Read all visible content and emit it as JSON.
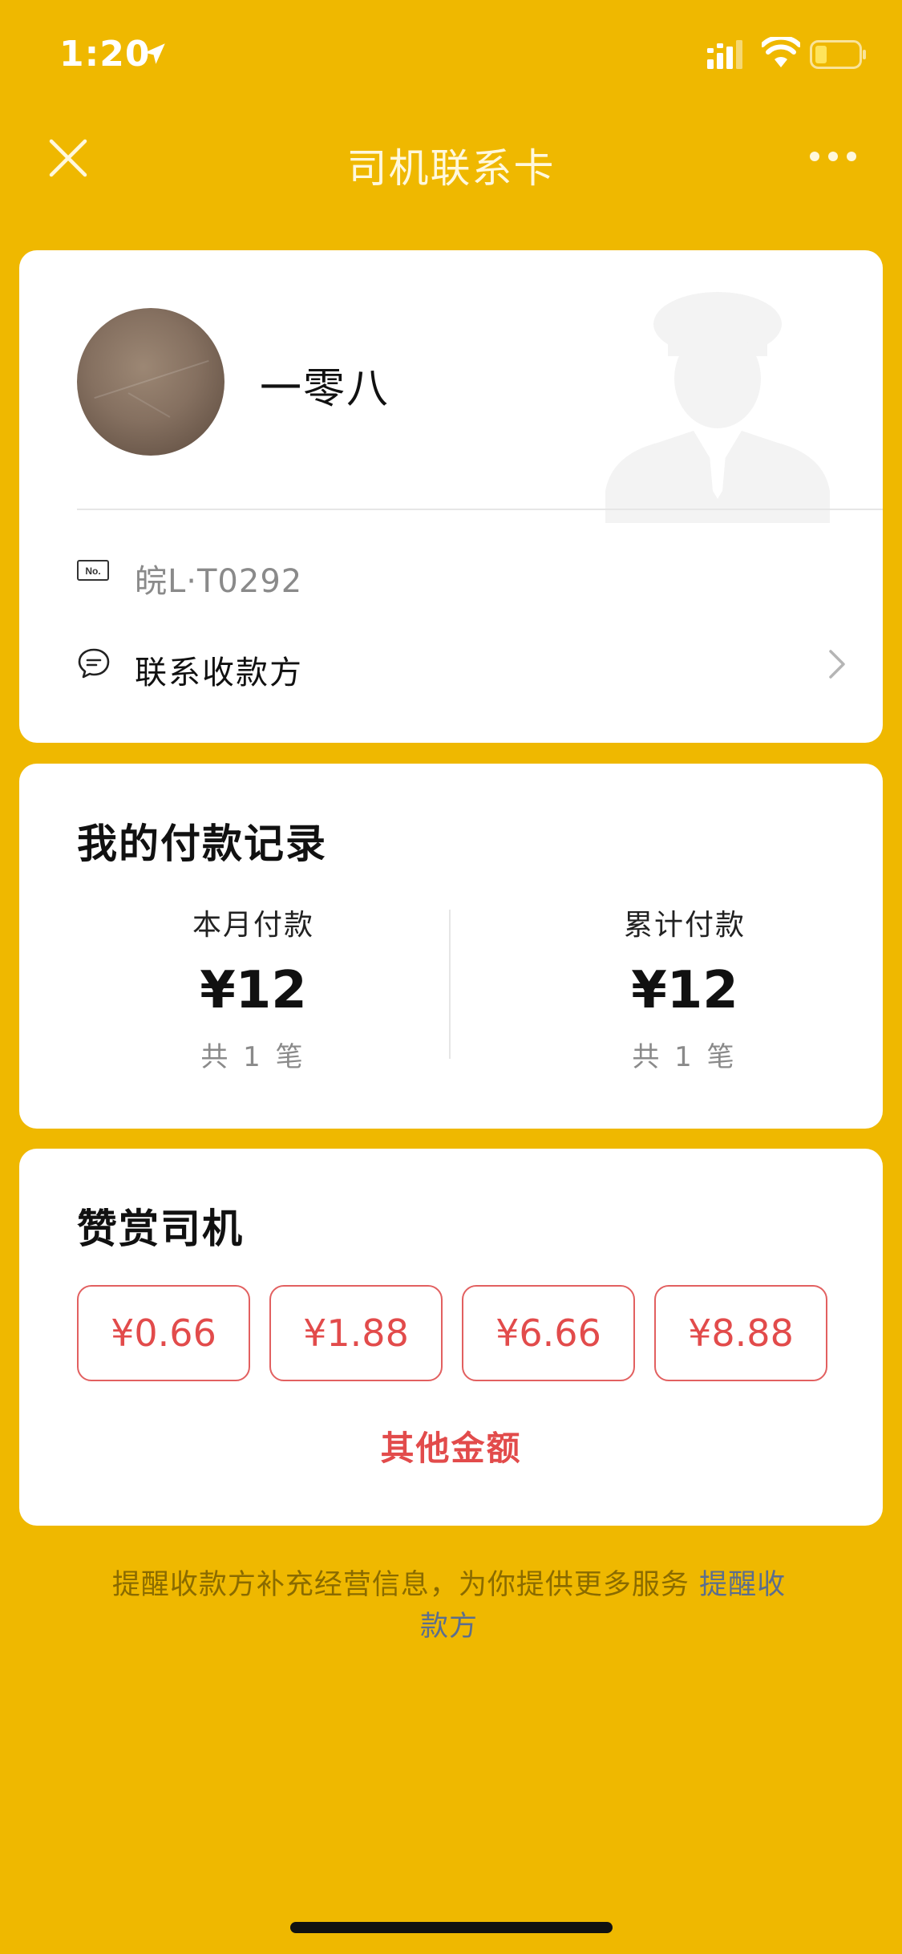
{
  "status_bar": {
    "time": "1:20"
  },
  "nav": {
    "title": "司机联系卡"
  },
  "driver": {
    "name": "一零八",
    "plate": "皖L·T0292",
    "plate_icon_label": "No.",
    "contact_label": "联系收款方"
  },
  "payments": {
    "title": "我的付款记录",
    "this_month": {
      "label": "本月付款",
      "amount": "¥12",
      "count": "共 1 笔"
    },
    "total": {
      "label": "累计付款",
      "amount": "¥12",
      "count": "共 1 笔"
    }
  },
  "tip": {
    "title": "赞赏司机",
    "options": [
      "¥0.66",
      "¥1.88",
      "¥6.66",
      "¥8.88"
    ],
    "other_label": "其他金额"
  },
  "footer": {
    "text": "提醒收款方补充经营信息，为你提供更多服务 ",
    "link": "提醒收款方"
  },
  "colors": {
    "background": "#EFB800",
    "accent_red": "#E24B4B",
    "link_blue": "#5B6E8E"
  }
}
